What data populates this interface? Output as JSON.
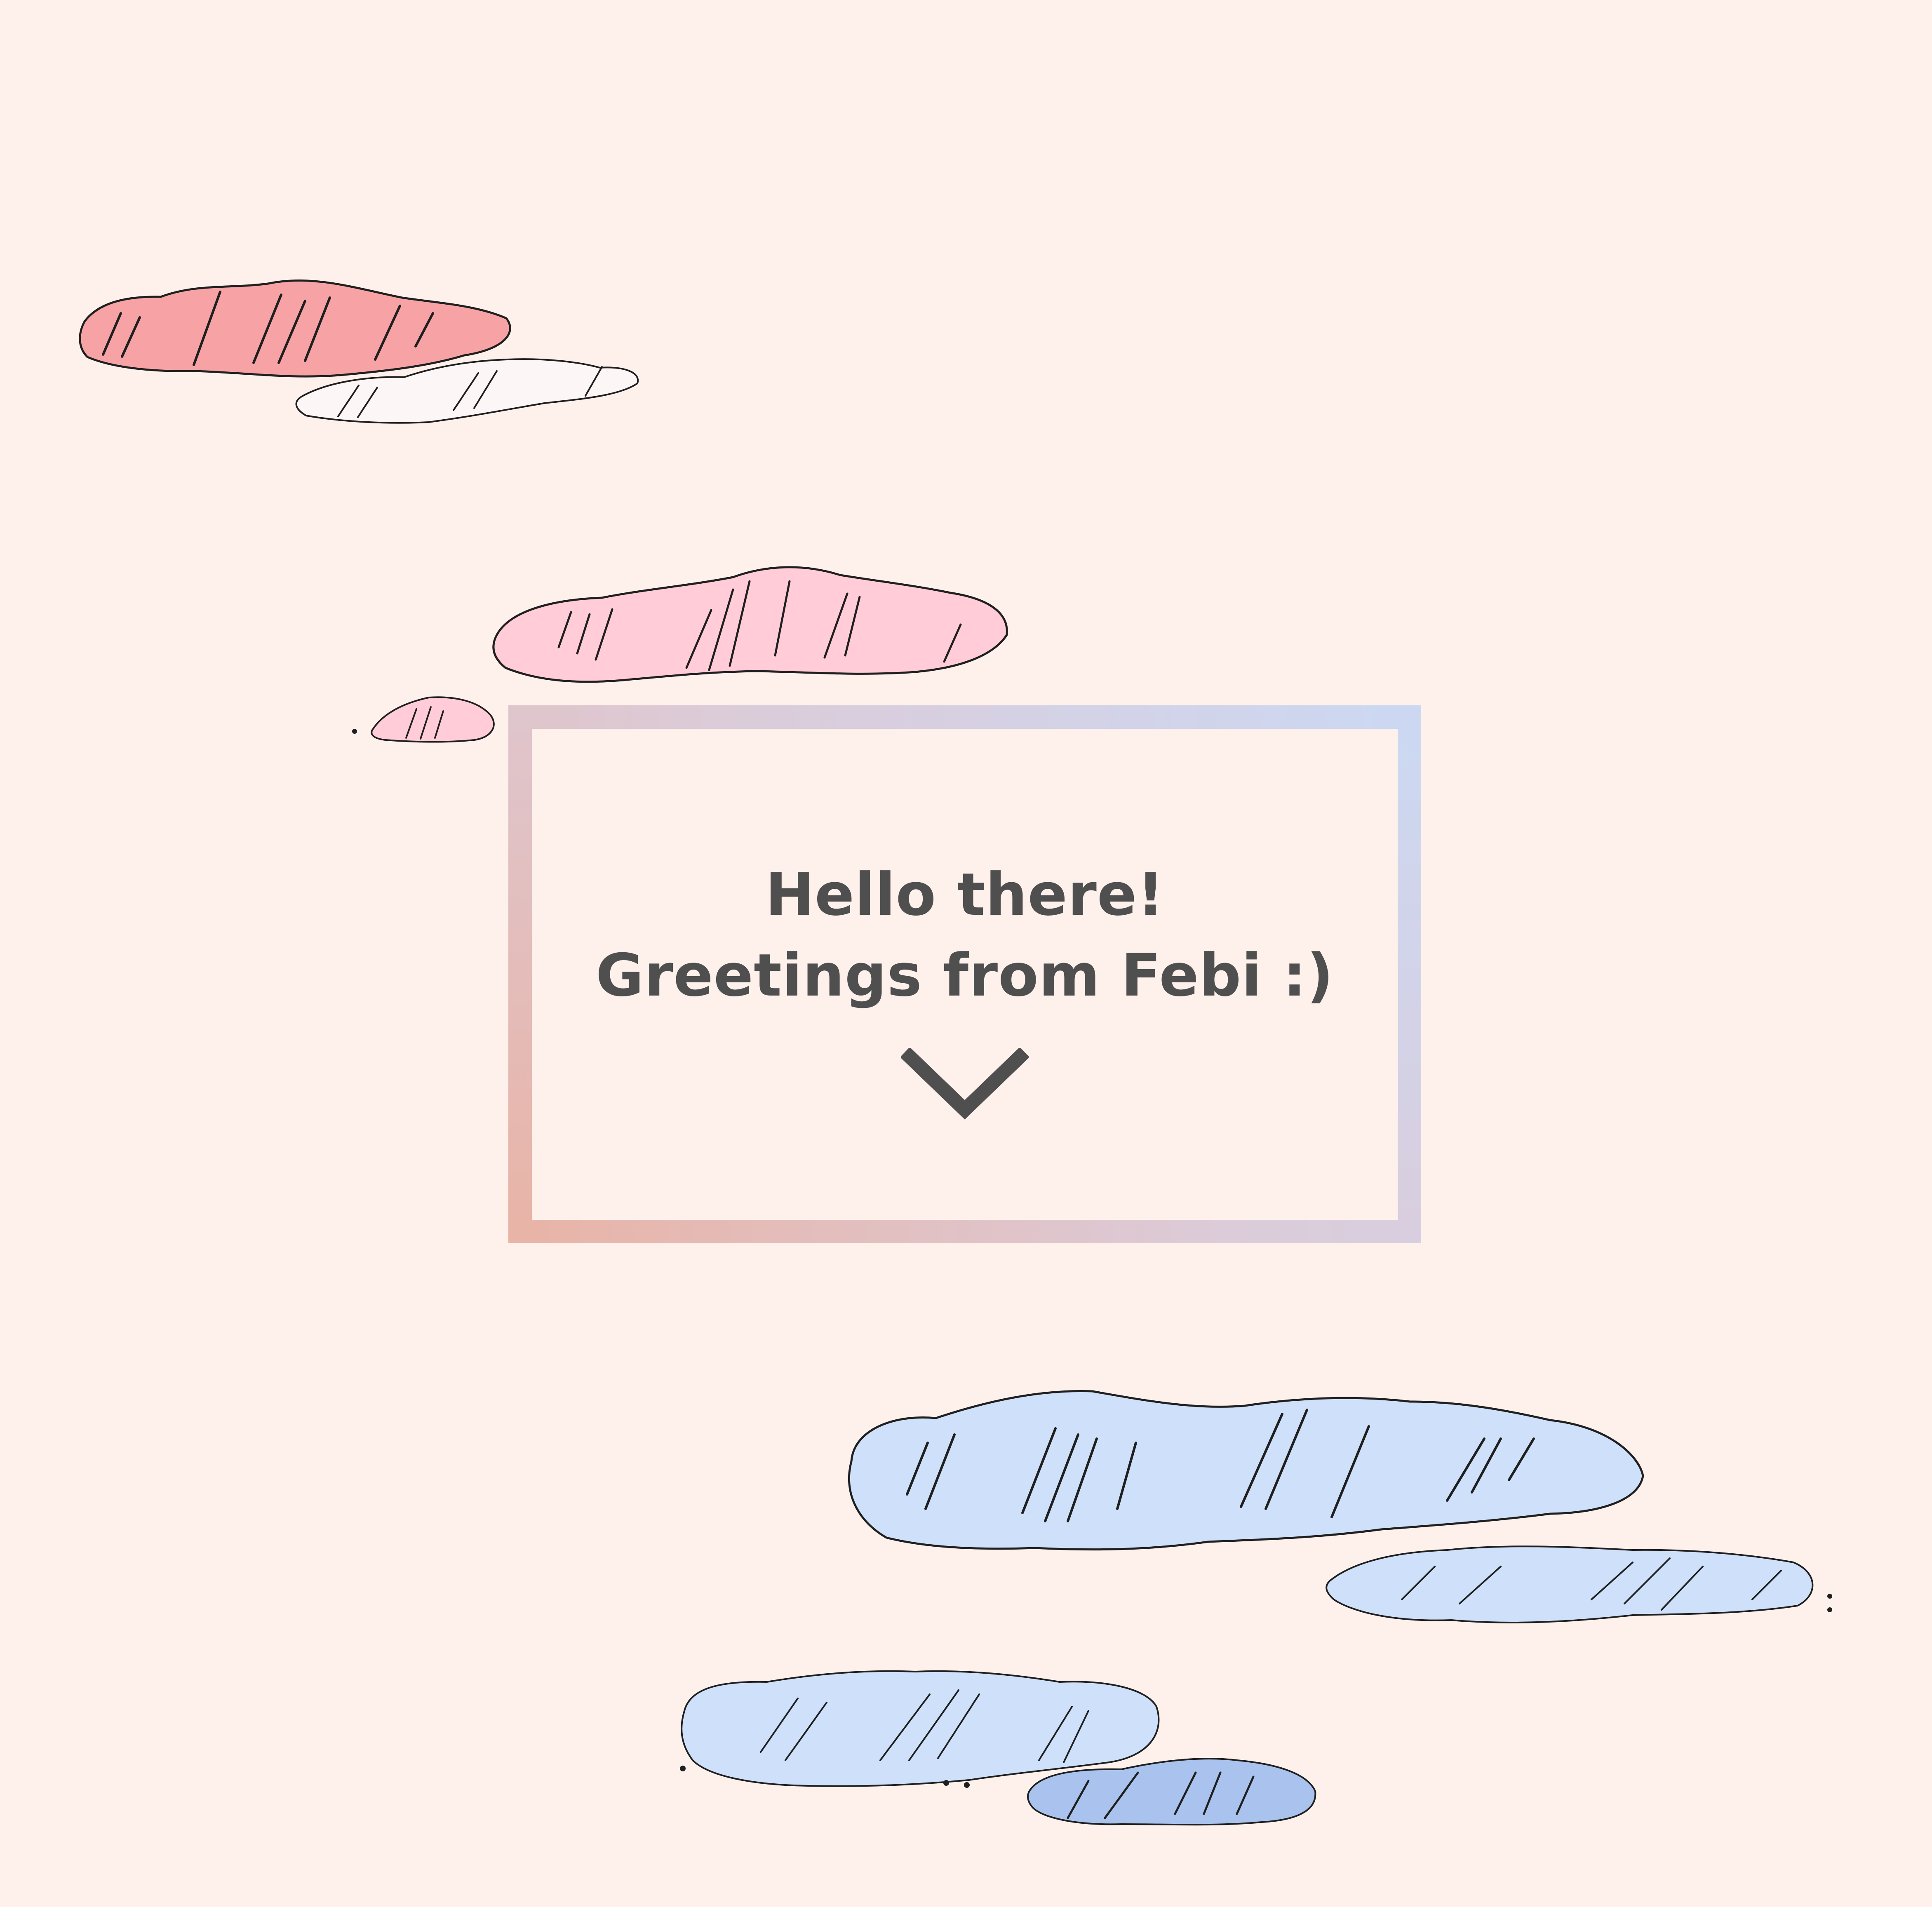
{
  "page": {
    "background": "#fef1ec"
  },
  "greeting": {
    "line1": "Hello there!",
    "line2": "Greetings from Febi :)",
    "text_color": "#4f4f4f",
    "scroll_icon": "chevron-down-icon"
  },
  "card": {
    "border_gradient": [
      "#e8b4a8",
      "#dccbd8",
      "#ccd8f2"
    ]
  },
  "clouds": {
    "pink_fill": "#f7a3a5",
    "light_pink_fill": "#ffccd8",
    "pale_fill": "#fdf6f7",
    "blue_fill": "#cfe0fb",
    "dark_blue_fill": "#a9c3ee",
    "sketch_stroke": "#1f1f1f"
  }
}
